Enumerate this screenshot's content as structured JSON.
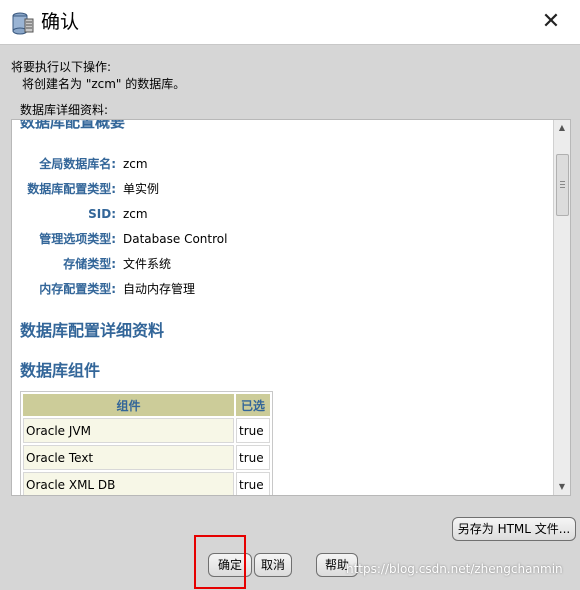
{
  "window": {
    "title": "确认",
    "icon": "database-icon",
    "close": "✕"
  },
  "intro": {
    "line1": "将要执行以下操作:",
    "line2": "将创建名为 \"zcm\" 的数据库。",
    "details_label": "数据库详细资料:"
  },
  "panel": {
    "cut_heading": "数据库配置概要",
    "summary": [
      {
        "key": "全局数据库名:",
        "value": "zcm"
      },
      {
        "key": "数据库配置类型:",
        "value": "单实例"
      },
      {
        "key": "SID:",
        "value": "zcm"
      },
      {
        "key": "管理选项类型:",
        "value": "Database Control"
      },
      {
        "key": "存储类型:",
        "value": "文件系统"
      },
      {
        "key": "内存配置类型:",
        "value": "自动内存管理"
      }
    ],
    "section_details": "数据库配置详细资料",
    "section_components": "数据库组件",
    "table": {
      "headers": [
        "组件",
        "已选"
      ],
      "rows": [
        [
          "Oracle JVM",
          "true"
        ],
        [
          "Oracle Text",
          "true"
        ],
        [
          "Oracle XML DB",
          "true"
        ]
      ]
    }
  },
  "buttons": {
    "save_html": "另存为 HTML 文件...",
    "ok": "确定",
    "cancel": "取消",
    "help": "帮助"
  },
  "watermark": "https://blog.csdn.net/zhengchanmin",
  "colors": {
    "heading": "#336699",
    "table_header": "#cccc99",
    "highlight": "#e60000"
  }
}
